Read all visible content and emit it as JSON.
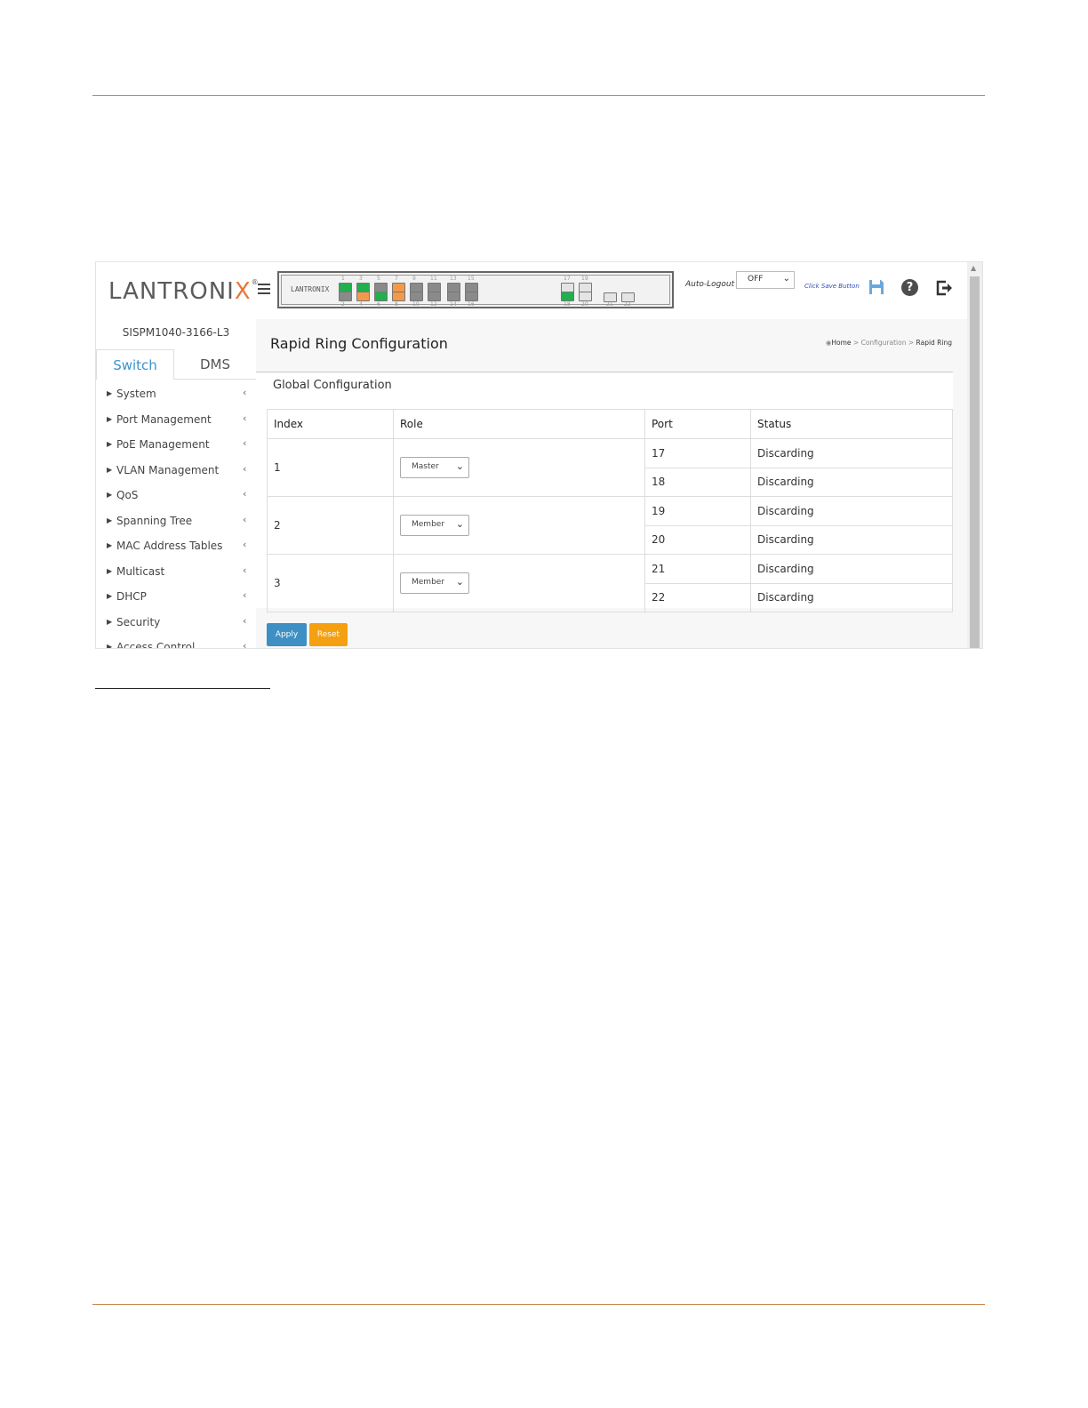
{
  "header": {
    "logo_text": "LANTRONI",
    "logo_x": "X",
    "logo_reg": "®",
    "panel_logo": "LANTRONIX",
    "auto_logout_label": "Auto-Logout",
    "auto_logout_value": "OFF",
    "save_hint": "Click Save Button",
    "icons": [
      "menu-icon",
      "save-icon",
      "help-icon",
      "logout-icon"
    ]
  },
  "ports": {
    "top_numbers": [
      "1",
      "3",
      "5",
      "7",
      "9",
      "11",
      "13",
      "15",
      "17",
      "19"
    ],
    "bottom_numbers": [
      "2",
      "4",
      "6",
      "8",
      "10",
      "12",
      "14",
      "16",
      "18",
      "20",
      "21",
      "22"
    ],
    "colors": {
      "green": "#21b04b",
      "orange": "#f39a4a",
      "gray": "#8a8a8a",
      "white": "#e4e4e4"
    }
  },
  "sidebar": {
    "model": "SISPM1040-3166-L3",
    "tabs": [
      {
        "label": "Switch",
        "active": true
      },
      {
        "label": "DMS",
        "active": false
      }
    ],
    "items": [
      {
        "label": "System"
      },
      {
        "label": "Port Management"
      },
      {
        "label": "PoE Management"
      },
      {
        "label": "VLAN Management"
      },
      {
        "label": "QoS"
      },
      {
        "label": "Spanning Tree"
      },
      {
        "label": "MAC Address Tables"
      },
      {
        "label": "Multicast"
      },
      {
        "label": "DHCP"
      },
      {
        "label": "Security"
      },
      {
        "label": "Access Control"
      }
    ]
  },
  "main": {
    "title": "Rapid Ring Configuration",
    "breadcrumb": [
      "Home",
      "Configuration",
      "Rapid Ring"
    ],
    "breadcrumb_sep": ">",
    "section": "Global Configuration",
    "columns": [
      "Index",
      "Role",
      "Port",
      "Status"
    ],
    "rings": [
      {
        "index": "1",
        "role": "Master",
        "ports": [
          {
            "port": "17",
            "status": "Discarding"
          },
          {
            "port": "18",
            "status": "Discarding"
          }
        ]
      },
      {
        "index": "2",
        "role": "Member",
        "ports": [
          {
            "port": "19",
            "status": "Discarding"
          },
          {
            "port": "20",
            "status": "Discarding"
          }
        ]
      },
      {
        "index": "3",
        "role": "Member",
        "ports": [
          {
            "port": "21",
            "status": "Discarding"
          },
          {
            "port": "22",
            "status": "Discarding"
          }
        ]
      }
    ],
    "apply_label": "Apply",
    "reset_label": "Reset",
    "colors": {
      "apply": "#3e8fc4",
      "reset": "#f5a011",
      "accent": "#3a94cf"
    }
  }
}
